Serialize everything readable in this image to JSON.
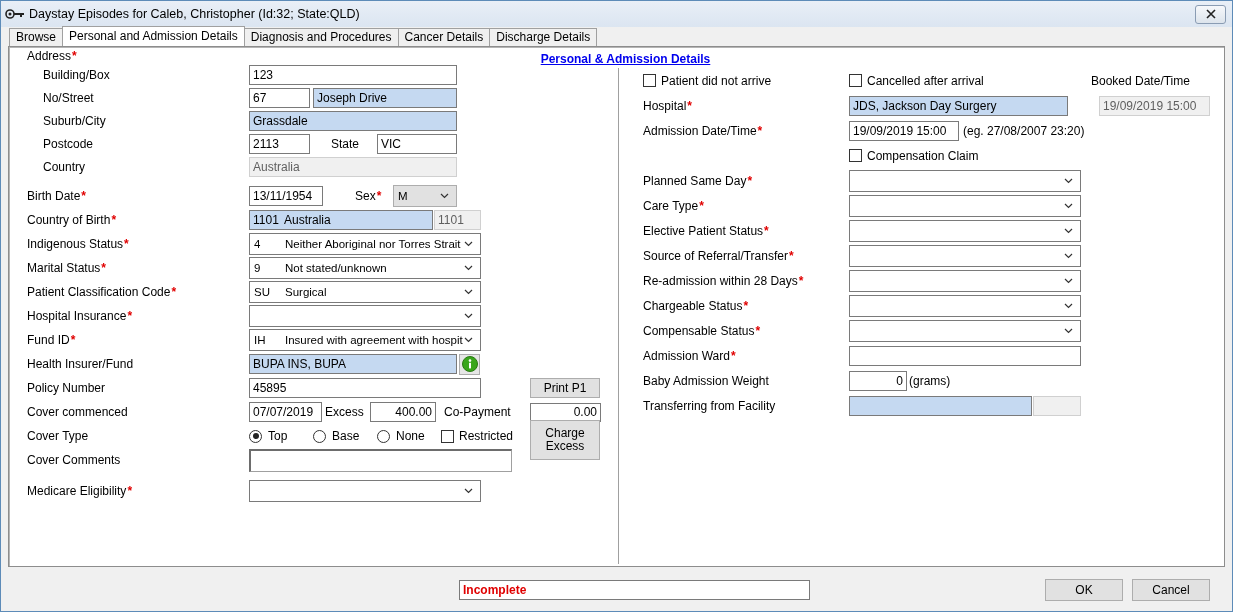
{
  "window": {
    "title": "Daystay Episodes for Caleb, Christopher (Id:32; State:QLD)"
  },
  "tabs": [
    {
      "label": "Browse",
      "selected": false
    },
    {
      "label": "Personal and Admission Details",
      "selected": true
    },
    {
      "label": "Diagnosis and Procedures",
      "selected": false
    },
    {
      "label": "Cancer Details",
      "selected": false
    },
    {
      "label": "Discharge Details",
      "selected": false
    }
  ],
  "form": {
    "heading": "Personal & Admission Details",
    "left": [
      {
        "label": "Address",
        "mark": "*",
        "children": [
          {
            "label": "Building/Box",
            "controls": [
              {
                "kind": "text",
                "value": "123"
              }
            ]
          },
          {
            "label": "No/Street",
            "controls": [
              {
                "kind": "text",
                "value": "67"
              },
              {
                "kind": "lookup",
                "value": "Joseph Drive"
              }
            ]
          },
          {
            "label": "Suburb/City",
            "controls": [
              {
                "kind": "lookup",
                "value": "Grassdale"
              }
            ]
          },
          {
            "label": "Postcode",
            "controls": [
              {
                "kind": "text",
                "value": "2113"
              },
              {
                "kind": "caption",
                "text": "State"
              },
              {
                "kind": "text",
                "value": "VIC"
              }
            ]
          },
          {
            "label": "Country",
            "controls": [
              {
                "kind": "readonly",
                "value": "Australia"
              }
            ]
          }
        ]
      },
      {
        "label": "Birth Date",
        "mark": "*",
        "controls": [
          {
            "kind": "text",
            "value": "13/11/1954"
          },
          {
            "kind": "caption",
            "text": "Sex",
            "mark": "*"
          },
          {
            "kind": "locked-combo",
            "value": "M"
          }
        ]
      },
      {
        "label": "Country of Birth",
        "mark": "*",
        "controls": [
          {
            "kind": "lookup",
            "code": "1101",
            "value": "Australia"
          },
          {
            "kind": "readonly",
            "value": "1101"
          }
        ]
      },
      {
        "label": "Indigenous Status",
        "mark": "*",
        "controls": [
          {
            "kind": "combo",
            "code": "4",
            "value": "Neither Aboriginal nor Torres Strait"
          }
        ]
      },
      {
        "label": "Marital Status",
        "mark": "*",
        "controls": [
          {
            "kind": "combo",
            "code": "9",
            "value": "Not stated/unknown"
          }
        ]
      },
      {
        "label": "Patient Classification Code",
        "mark": "*",
        "controls": [
          {
            "kind": "combo",
            "code": "SU",
            "value": "Surgical"
          }
        ]
      },
      {
        "label": "Hospital Insurance",
        "mark": "*",
        "controls": [
          {
            "kind": "combo"
          }
        ]
      },
      {
        "label": "Fund ID",
        "mark": "*",
        "controls": [
          {
            "kind": "combo",
            "code": "IH",
            "value": "Insured with agreement with hospit"
          }
        ]
      },
      {
        "label": "Health Insurer/Fund",
        "controls": [
          {
            "kind": "lookup",
            "value": "BUPA INS, BUPA"
          },
          {
            "kind": "info"
          }
        ]
      },
      {
        "label": "Policy Number",
        "controls": [
          {
            "kind": "text",
            "value": "45895"
          },
          {
            "kind": "button",
            "text": "Print P1"
          }
        ]
      },
      {
        "label": "Cover commenced",
        "controls": [
          {
            "kind": "text",
            "value": "07/07/2019"
          },
          {
            "kind": "caption",
            "text": "Excess"
          },
          {
            "kind": "number",
            "value": "400.00"
          },
          {
            "kind": "caption",
            "text": "Co-Payment"
          },
          {
            "kind": "number",
            "value": "0.00"
          }
        ]
      },
      {
        "label": "Cover Type",
        "controls": [
          {
            "kind": "radio",
            "text": "Top",
            "selected": true
          },
          {
            "kind": "radio",
            "text": "Base",
            "selected": false
          },
          {
            "kind": "radio",
            "text": "None",
            "selected": false
          },
          {
            "kind": "checkbox",
            "text": "Restricted",
            "checked": false
          },
          {
            "kind": "button",
            "text": "Charge Excess"
          }
        ]
      },
      {
        "label": "Cover Comments",
        "controls": [
          {
            "kind": "memo"
          }
        ]
      },
      {
        "label": "Medicare Eligibility",
        "mark": "*",
        "controls": [
          {
            "kind": "combo"
          }
        ]
      }
    ],
    "right": [
      {
        "lead": {
          "kind": "checkbox",
          "text": "Patient did not arrive",
          "checked": false
        },
        "controls": [
          {
            "kind": "checkbox",
            "text": "Cancelled after arrival",
            "checked": false
          },
          {
            "kind": "caption",
            "text": "Booked Date/Time"
          }
        ]
      },
      {
        "label": "Hospital",
        "mark": "*",
        "controls": [
          {
            "kind": "lookup",
            "value": "JDS, Jackson Day Surgery"
          },
          {
            "kind": "readonly",
            "value": "19/09/2019 15:00"
          }
        ]
      },
      {
        "label": "Admission Date/Time",
        "mark": "*",
        "controls": [
          {
            "kind": "text",
            "value": "19/09/2019 15:00"
          },
          {
            "kind": "caption",
            "text": "(eg. 27/08/2007 23:20)"
          }
        ]
      },
      {
        "controls": [
          {
            "kind": "checkbox",
            "text": "Compensation Claim",
            "checked": false
          }
        ]
      },
      {
        "label": "Planned Same Day",
        "mark": "*",
        "controls": [
          {
            "kind": "combo"
          }
        ]
      },
      {
        "label": "Care Type",
        "mark": "*",
        "controls": [
          {
            "kind": "combo"
          }
        ]
      },
      {
        "label": "Elective Patient Status",
        "mark": "*",
        "controls": [
          {
            "kind": "combo"
          }
        ]
      },
      {
        "label": "Source of Referral/Transfer",
        "mark": "*",
        "controls": [
          {
            "kind": "combo"
          }
        ]
      },
      {
        "label": "Re-admission within 28 Days",
        "mark": "*",
        "controls": [
          {
            "kind": "combo"
          }
        ]
      },
      {
        "label": "Chargeable Status",
        "mark": "*",
        "controls": [
          {
            "kind": "combo"
          }
        ]
      },
      {
        "label": "Compensable Status",
        "mark": "*",
        "controls": [
          {
            "kind": "combo"
          }
        ]
      },
      {
        "label": "Admission Ward",
        "mark": "*",
        "controls": [
          {
            "kind": "text"
          }
        ]
      },
      {
        "label": "Baby Admission Weight",
        "controls": [
          {
            "kind": "number",
            "value": "0"
          },
          {
            "kind": "caption",
            "text": "(grams)"
          }
        ]
      },
      {
        "label": "Transferring from Facility",
        "controls": [
          {
            "kind": "lookup"
          },
          {
            "kind": "readonly"
          }
        ]
      }
    ]
  },
  "footer": {
    "status": "Incomplete",
    "buttons": [
      "OK",
      "Cancel"
    ]
  }
}
